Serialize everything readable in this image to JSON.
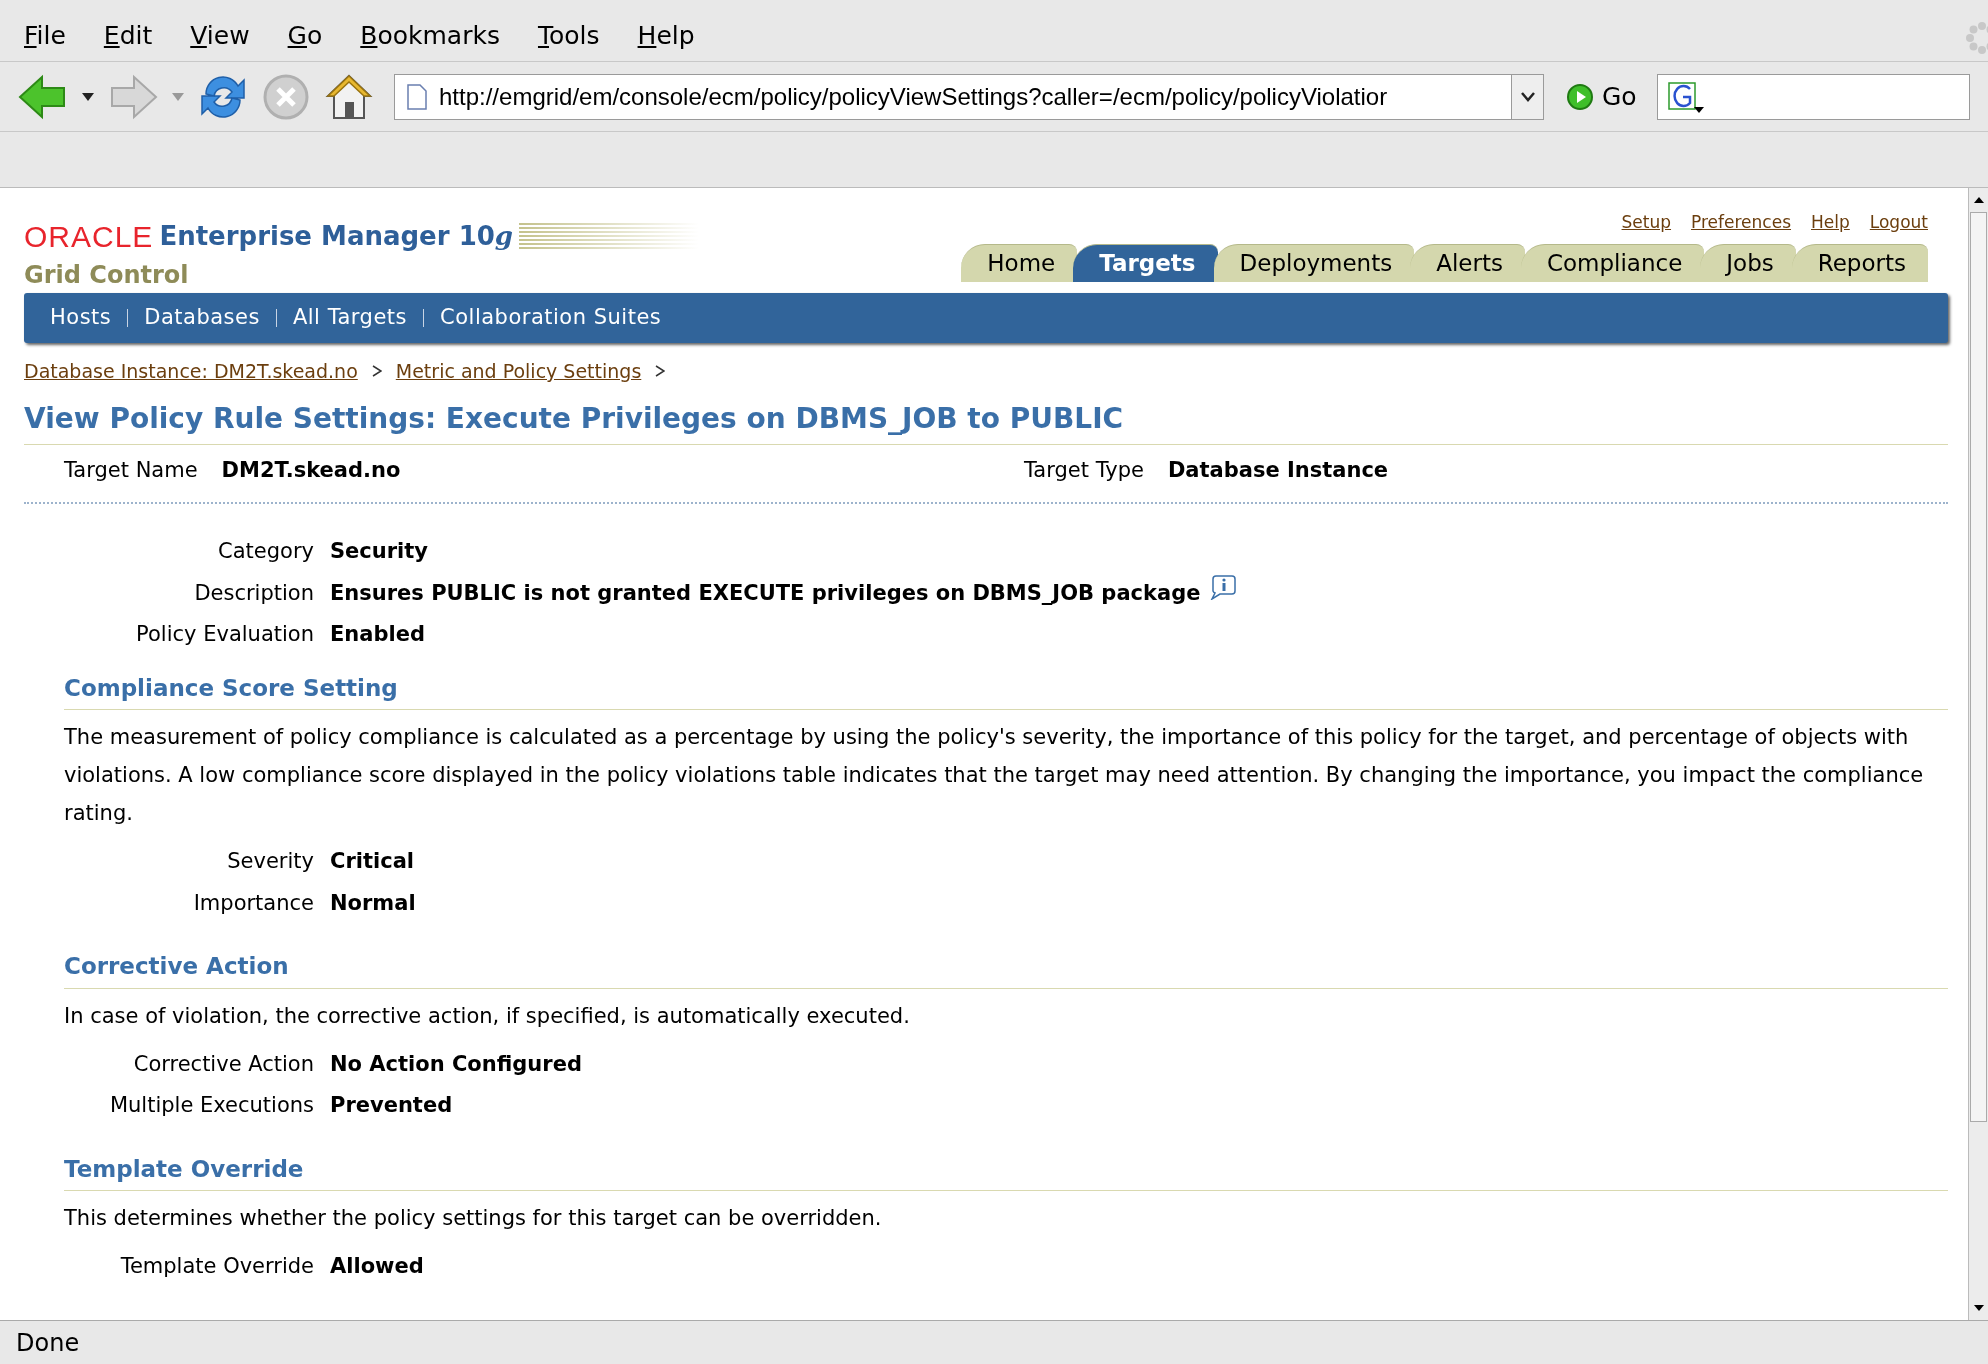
{
  "menu": [
    {
      "label": "File"
    },
    {
      "label": "Edit"
    },
    {
      "label": "View"
    },
    {
      "label": "Go"
    },
    {
      "label": "Bookmarks"
    },
    {
      "label": "Tools"
    },
    {
      "label": "Help"
    }
  ],
  "toolbar": {
    "url": "http://emgrid/em/console/ecm/policy/policyViewSettings?caller=/ecm/policy/policyViolatior",
    "go": "Go"
  },
  "header": {
    "brand": "ORACLE",
    "product": "Enterprise Manager 10",
    "product_suffix": "g",
    "subtitle": "Grid Control",
    "global_links": [
      "Setup",
      "Preferences",
      "Help",
      "Logout"
    ],
    "tabs": [
      {
        "label": "Home",
        "selected": false
      },
      {
        "label": "Targets",
        "selected": true
      },
      {
        "label": "Deployments",
        "selected": false
      },
      {
        "label": "Alerts",
        "selected": false
      },
      {
        "label": "Compliance",
        "selected": false
      },
      {
        "label": "Jobs",
        "selected": false
      },
      {
        "label": "Reports",
        "selected": false
      }
    ],
    "subtabs": [
      "Hosts",
      "Databases",
      "All Targets",
      "Collaboration Suites"
    ]
  },
  "breadcrumbs": [
    "Database Instance: DM2T.skead.no",
    "Metric and Policy Settings"
  ],
  "title": "View Policy Rule Settings: Execute Privileges on DBMS_JOB to PUBLIC",
  "target": [
    {
      "label": "Target Name",
      "value": "DM2T.skead.no"
    },
    {
      "label": "Target Type",
      "value": "Database Instance"
    }
  ],
  "details": [
    {
      "label": "Category",
      "value": "Security",
      "info": false
    },
    {
      "label": "Description",
      "value": "Ensures PUBLIC is not granted EXECUTE privileges on DBMS_JOB package",
      "info": true
    },
    {
      "label": "Policy Evaluation",
      "value": "Enabled",
      "info": false
    }
  ],
  "sections": [
    {
      "heading": "Compliance Score Setting",
      "text": "The measurement of policy compliance is calculated as a percentage by using the policy's severity, the importance of this policy for the target, and percentage of objects with violations. A low compliance score displayed in the policy violations table indicates that the target may need attention. By changing the importance, you impact the compliance rating.",
      "fields": [
        {
          "label": "Severity",
          "value": "Critical"
        },
        {
          "label": "Importance",
          "value": "Normal"
        }
      ]
    },
    {
      "heading": "Corrective Action",
      "text": "In case of violation, the corrective action, if specified, is automatically executed.",
      "fields": [
        {
          "label": "Corrective Action",
          "value": "No Action Configured"
        },
        {
          "label": "Multiple Executions",
          "value": "Prevented"
        }
      ]
    },
    {
      "heading": "Template Override",
      "text": "This determines whether the policy settings for this target can be overridden.",
      "fields": [
        {
          "label": "Template Override",
          "value": "Allowed"
        }
      ]
    }
  ],
  "status_bar": "Done"
}
